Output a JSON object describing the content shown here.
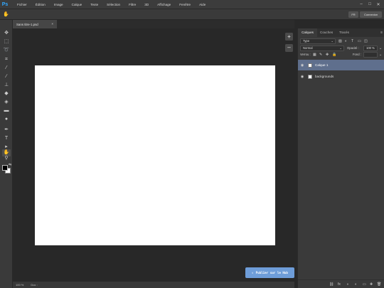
{
  "app": {
    "logo": "Ps"
  },
  "menu": [
    "Fichier",
    "Édition",
    "Image",
    "Calque",
    "Texte",
    "Sélection",
    "Filtre",
    "3D",
    "Affichage",
    "Fenêtre",
    "Aide"
  ],
  "window_controls": {
    "minimize": "–",
    "maximize": "□",
    "close": "✕"
  },
  "options_bar": {
    "tool_icon": "hand-icon",
    "tool_glyph": "✋",
    "share_label": "FR",
    "connexion_label": "Connexion"
  },
  "toolbar": {
    "tools": [
      {
        "name": "move-tool-icon",
        "glyph": "✥"
      },
      {
        "name": "marquee-tool-icon",
        "glyph": "⬚"
      },
      {
        "name": "lasso-tool-icon",
        "glyph": "➰"
      },
      {
        "name": "crop-tool-icon",
        "glyph": "⌗"
      },
      {
        "name": "eyedropper-tool-icon",
        "glyph": "⁄"
      },
      {
        "name": "brush-tool-icon",
        "glyph": "∕"
      },
      {
        "name": "stamp-tool-icon",
        "glyph": "⊥"
      },
      {
        "name": "eraser-tool-icon",
        "glyph": "◆"
      },
      {
        "name": "bucket-tool-icon",
        "glyph": "◈"
      },
      {
        "name": "gradient-tool-icon",
        "glyph": "▬"
      },
      {
        "name": "blur-tool-icon",
        "glyph": "●"
      },
      {
        "name": "pen-tool-icon",
        "glyph": "✒"
      },
      {
        "name": "text-tool-icon",
        "glyph": "T"
      },
      {
        "name": "select-tool-icon",
        "glyph": "▸"
      },
      {
        "name": "hand-tool-icon",
        "glyph": "✋"
      },
      {
        "name": "zoom-tool-icon",
        "glyph": "⚲"
      }
    ],
    "swap_glyph": "⇆",
    "foreground_color": "#000000",
    "background_color": "#ffffff"
  },
  "document": {
    "tab_title": "Sans titre-1.psd",
    "close_glyph": "×"
  },
  "canvas": {
    "zoom_in_glyph": "+",
    "zoom_out_glyph": "–",
    "publish_icon": "upload-icon",
    "publish_glyph": "⇪",
    "publish_label": "Publier sur le Hub",
    "accent_color": "#6e9dd9"
  },
  "status_bar": {
    "zoom": "100 %",
    "doc_info": "Doc :"
  },
  "panel": {
    "tabs": [
      "Calques",
      "Couches",
      "Tracés"
    ],
    "menu_glyph": "≡",
    "filter_type": "Type",
    "blend_mode": "Normal",
    "opacity_label": "Opacité :",
    "opacity_value": "100 %",
    "lock_label": "Verrou :",
    "fill_label": "Fond :",
    "fill_value": "",
    "caret_glyph": "⌄",
    "filter_icons": [
      "▨",
      "◐",
      "T",
      "▭",
      "◫"
    ],
    "lock_icons": [
      "▦",
      "✎",
      "✥",
      "🔒"
    ],
    "layers": [
      {
        "name": "Calque 1",
        "visible_glyph": "◉",
        "selected": true
      },
      {
        "name": "backgrounds",
        "visible_glyph": "◉",
        "selected": false
      }
    ],
    "footer_icons": [
      "⛓",
      "fx",
      "◑",
      "◐",
      "▭",
      "✚",
      "🗑"
    ]
  }
}
